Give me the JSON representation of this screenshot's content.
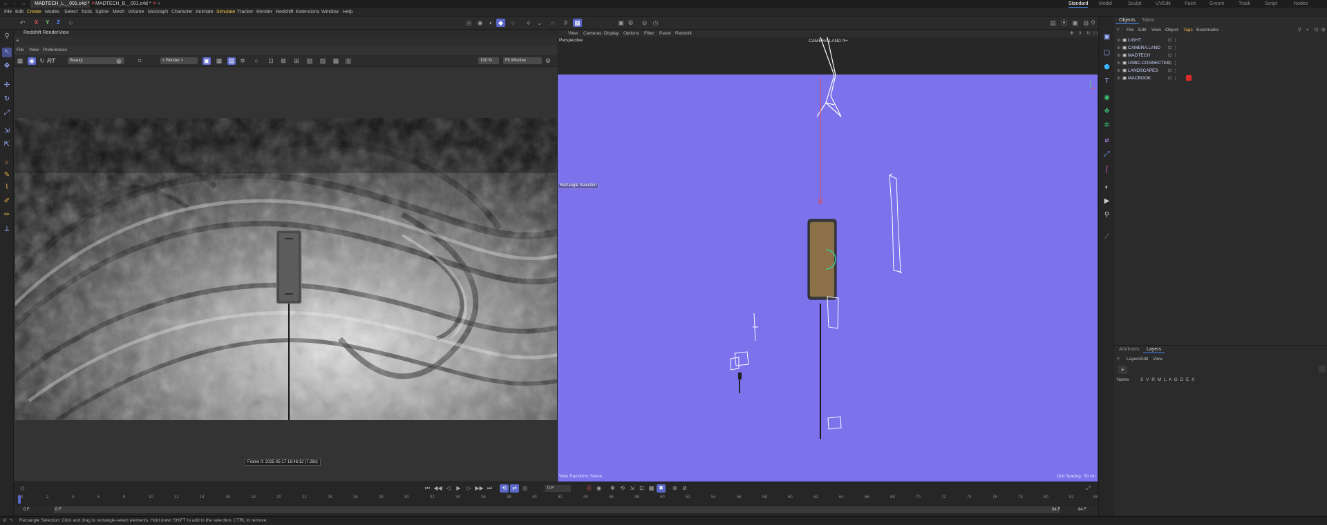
{
  "file_tabs": [
    "MADTECH_L__001.c4d *",
    "MADTECH_B__001.c4d *"
  ],
  "layouts": [
    "Standard",
    "Model",
    "Sculpt",
    "UVEdit",
    "Paint",
    "Groom",
    "Track",
    "Script",
    "Nodes"
  ],
  "menu": [
    "File",
    "Edit",
    "Create",
    "Modes",
    "Select",
    "Tools",
    "Spline",
    "Mesh",
    "Volume",
    "MoGraph",
    "Character",
    "Animate",
    "Simulate",
    "Tracker",
    "Render",
    "Redshift",
    "Extensions",
    "Window",
    "Help"
  ],
  "axis_labels": [
    "X",
    "Y",
    "Z"
  ],
  "renderview": {
    "title": "Redshift RenderView",
    "menu": [
      "File",
      "View",
      "Preferences"
    ],
    "aov": "Beauty",
    "render_mode": "< Render >",
    "zoom": "100 %",
    "fit": "Fit Window",
    "frame_info": "Frame  0:  2025-05-17  16:46:12  (7.28s)"
  },
  "viewport": {
    "menu": [
      "View",
      "Cameras",
      "Display",
      "Options",
      "Filter",
      "Panel",
      "Redshift"
    ],
    "name": "Perspective",
    "camera": "CAMERA.LAND",
    "camera_suffix": "⟳•",
    "tool_hint": "Rectangle Selection",
    "view_transform": "View Transform: Scene",
    "grid_spacing": "Grid Spacing : 50 cm",
    "accent": "#7b72ec"
  },
  "objects": {
    "tabs": [
      "Objects",
      "Takes"
    ],
    "menu": [
      "File",
      "Edit",
      "View",
      "Object",
      "Tags",
      "Bookmarks"
    ],
    "items": [
      "LIGHT",
      "CAMERA.LAND",
      "MADTECH",
      "USBC.CONNECTED",
      "LANDSCAPES",
      "MACBOOK"
    ]
  },
  "layers": {
    "tabs": [
      "Attributes",
      "Layers"
    ],
    "menu": [
      "Layers",
      "Edit",
      "View"
    ],
    "name_header": "Name",
    "columns": "S V R M L A G D E X"
  },
  "timeline": {
    "ticks": [
      "0",
      "2",
      "4",
      "6",
      "8",
      "10",
      "12",
      "14",
      "16",
      "18",
      "20",
      "22",
      "24",
      "26",
      "28",
      "30",
      "32",
      "34",
      "36",
      "38",
      "40",
      "42",
      "44",
      "46",
      "48",
      "50",
      "52",
      "54",
      "56",
      "58",
      "60",
      "62",
      "64",
      "66",
      "68",
      "70",
      "72",
      "74",
      "76",
      "78",
      "80",
      "82",
      "84"
    ],
    "current_frame": "0 F",
    "start": "0 F",
    "start2": "0 F",
    "end": "84 F",
    "end2": "84 F"
  },
  "status": "Rectangle Selection: Click and drag to rectangle-select elements. Hold down SHIFT to add to the selection, CTRL to remove."
}
